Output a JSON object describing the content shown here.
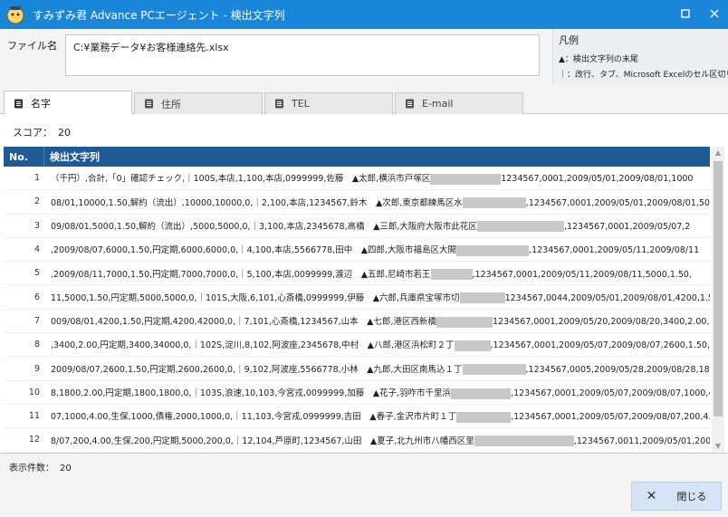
{
  "window": {
    "title": "すみずみ君 Advance PCエージェント - 検出文字列"
  },
  "file": {
    "label": "ファイル名",
    "colon": "：",
    "path": "C:¥業務データ¥お客様連絡先.xlsx"
  },
  "legend": {
    "title": "凡例",
    "line1": "▲：検出文字列の末尾",
    "line2": "｜：改行、タブ、Microsoft Excelのセル区切り"
  },
  "tabs": [
    {
      "label": "名字",
      "active": true
    },
    {
      "label": "住所",
      "active": false
    },
    {
      "label": "TEL",
      "active": false
    },
    {
      "label": "E-mail",
      "active": false
    }
  ],
  "score": {
    "label": "スコア：",
    "value": "20"
  },
  "grid": {
    "col_no": "No.",
    "col_text": "検出文字列",
    "rows": [
      {
        "no": "1",
        "pre": "（千円）,合計,「0」確認チェック,｜100S,本店,1,100,本店,0999999,佐藤　▲太郎,横浜市戸塚区",
        "post": "1234567,0001,2009/05/01,2009/08/01,1000"
      },
      {
        "no": "2",
        "pre": "08/01,10000,1.50,解約（流出）,10000,10000,0,｜2,100,本店,1234567,鈴木　▲次郎,東京都練馬区水",
        "post": ",1234567,0001,2009/05/01,2009/08/01,5000,"
      },
      {
        "no": "3",
        "pre": "09/08/01,5000,1.50,解約（流出）,5000,5000,0,｜3,100,本店,2345678,高橋　▲三郎,大阪府大阪市此花区",
        "post": ",1234567,0001,2009/05/07,2"
      },
      {
        "no": "4",
        "pre": ",2009/08/07,6000,1.50,円定期,6000,6000,0,｜4,100,本店,5566778,田中　▲四郎,大阪市福島区大開",
        "post": ",1234567,0001,2009/05/11,2009/08/11"
      },
      {
        "no": "5",
        "pre": ",2009/08/11,7000,1.50,円定期,7000,7000,0,｜5,100,本店,0099999,渡辺　▲五郎,尼崎市若王",
        "post": ",1234567,0001,2009/05/11,2009/08/11,5000,1.50,"
      },
      {
        "no": "6",
        "pre": "11,5000,1.50,円定期,5000,5000,0,｜101S,大阪,6,101,心斎橋,0999999,伊藤　▲六郎,兵庫県宝塚市切",
        "post": "1234567,0044,2009/05/01,2009/08/01,4200,1.50"
      },
      {
        "no": "7",
        "pre": "009/08/01,4200,1.50,円定期,4200,42000,0,｜7,101,心斎橋,1234567,山本　▲七郎,港区西新橋",
        "post": "1234567,0001,2009/05/20,2009/08/20,3400,2.00,"
      },
      {
        "no": "8",
        "pre": ",3400,2.00,円定期,3400,34000,0,｜102S,淀川,8,102,阿波座,2345678,中村　▲八郎,港区浜松町２丁",
        "post": ",1234567,0001,2009/05/07,2009/08/07,2600,1.50,"
      },
      {
        "no": "9",
        "pre": "2009/08/07,2600,1.50,円定期,2600,2600,0,｜9,102,阿波座,5566778,小林　▲九郎,大田区南馬込１丁",
        "post": ",1234567,0005,2009/05/28,2009/08/28,1800,"
      },
      {
        "no": "10",
        "pre": "8,1800,2.00,円定期,1800,1800,0,｜103S,浪速,10,103,今宮戎,0099999,加藤　▲花子,羽咋市千里浜",
        "post": ",1234567,0001,2009/05/07,2009/08/07,1000,4.00"
      },
      {
        "no": "11",
        "pre": "07,1000,4.00,生保,1000,債権,2000,1000,0,｜11,103,今宮戎,0999999,吉田　▲春子,金沢市片町１丁",
        "post": ",1234567,0001,2009/05/07,2009/08/07,200,4.00,"
      },
      {
        "no": "12",
        "pre": "8/07,200,4.00,生保,200,円定期,5000,200,0,｜12,104,芦原町,1234567,山田　▲夏子,北九州市八幡西区里",
        "post": ",1234567,0011,2009/05/01,2009/08/01"
      }
    ]
  },
  "footer": {
    "count_label": "表示件数：",
    "count_value": "20",
    "close_label": "閉じる"
  },
  "colors": {
    "titlebar": "#1a86d9",
    "grid_header": "#1e5a96"
  }
}
